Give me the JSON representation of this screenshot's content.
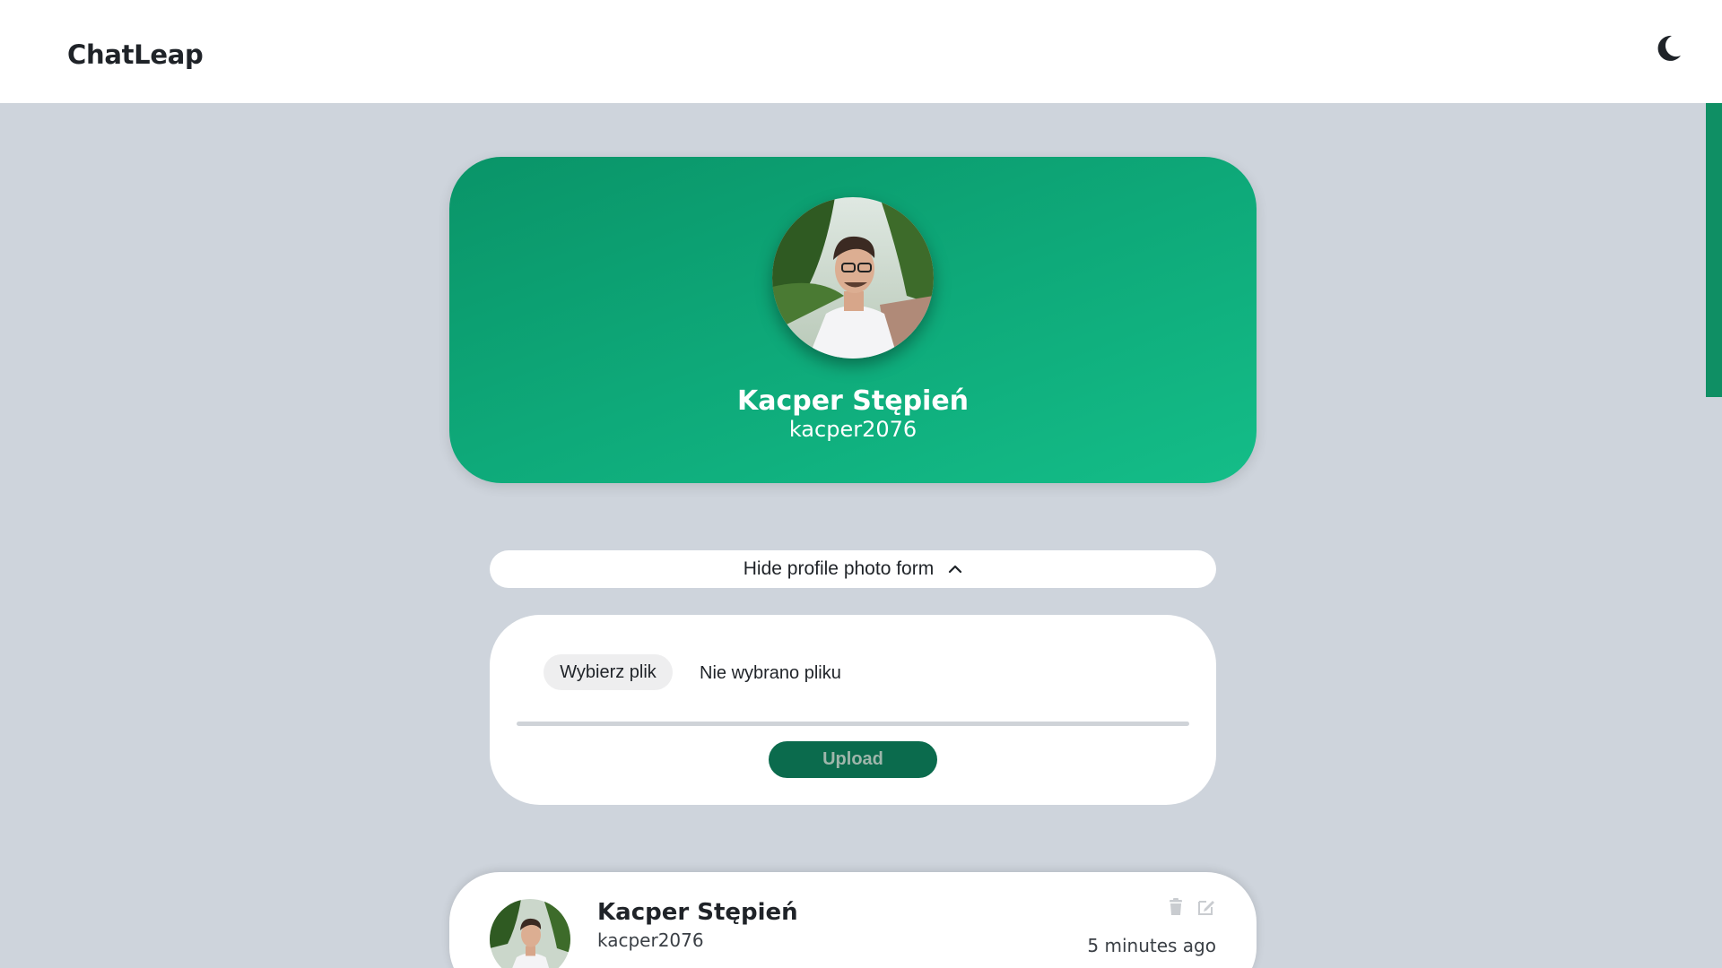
{
  "navbar": {
    "brand": "ChatLeap",
    "theme_toggle_icon": "moon-icon"
  },
  "profile": {
    "name": "Kacper Stępień",
    "username": "kacper2076",
    "avatar_icon": "avatar-photo"
  },
  "photo_form": {
    "toggle_label": "Hide profile photo form",
    "toggle_icon": "chevron-up-icon",
    "choose_file_label": "Wybierz plik",
    "file_status": "Nie wybrano pliku",
    "upload_label": "Upload",
    "upload_progress": 0
  },
  "post": {
    "author_name": "Kacper Stępień",
    "author_username": "kacper2076",
    "time": "5 minutes ago",
    "delete_icon": "trash-icon",
    "edit_icon": "edit-icon"
  },
  "colors": {
    "brand_green": "#0ea979",
    "upload_button": "#0b6b4d",
    "page_background": "#ced4dc"
  }
}
